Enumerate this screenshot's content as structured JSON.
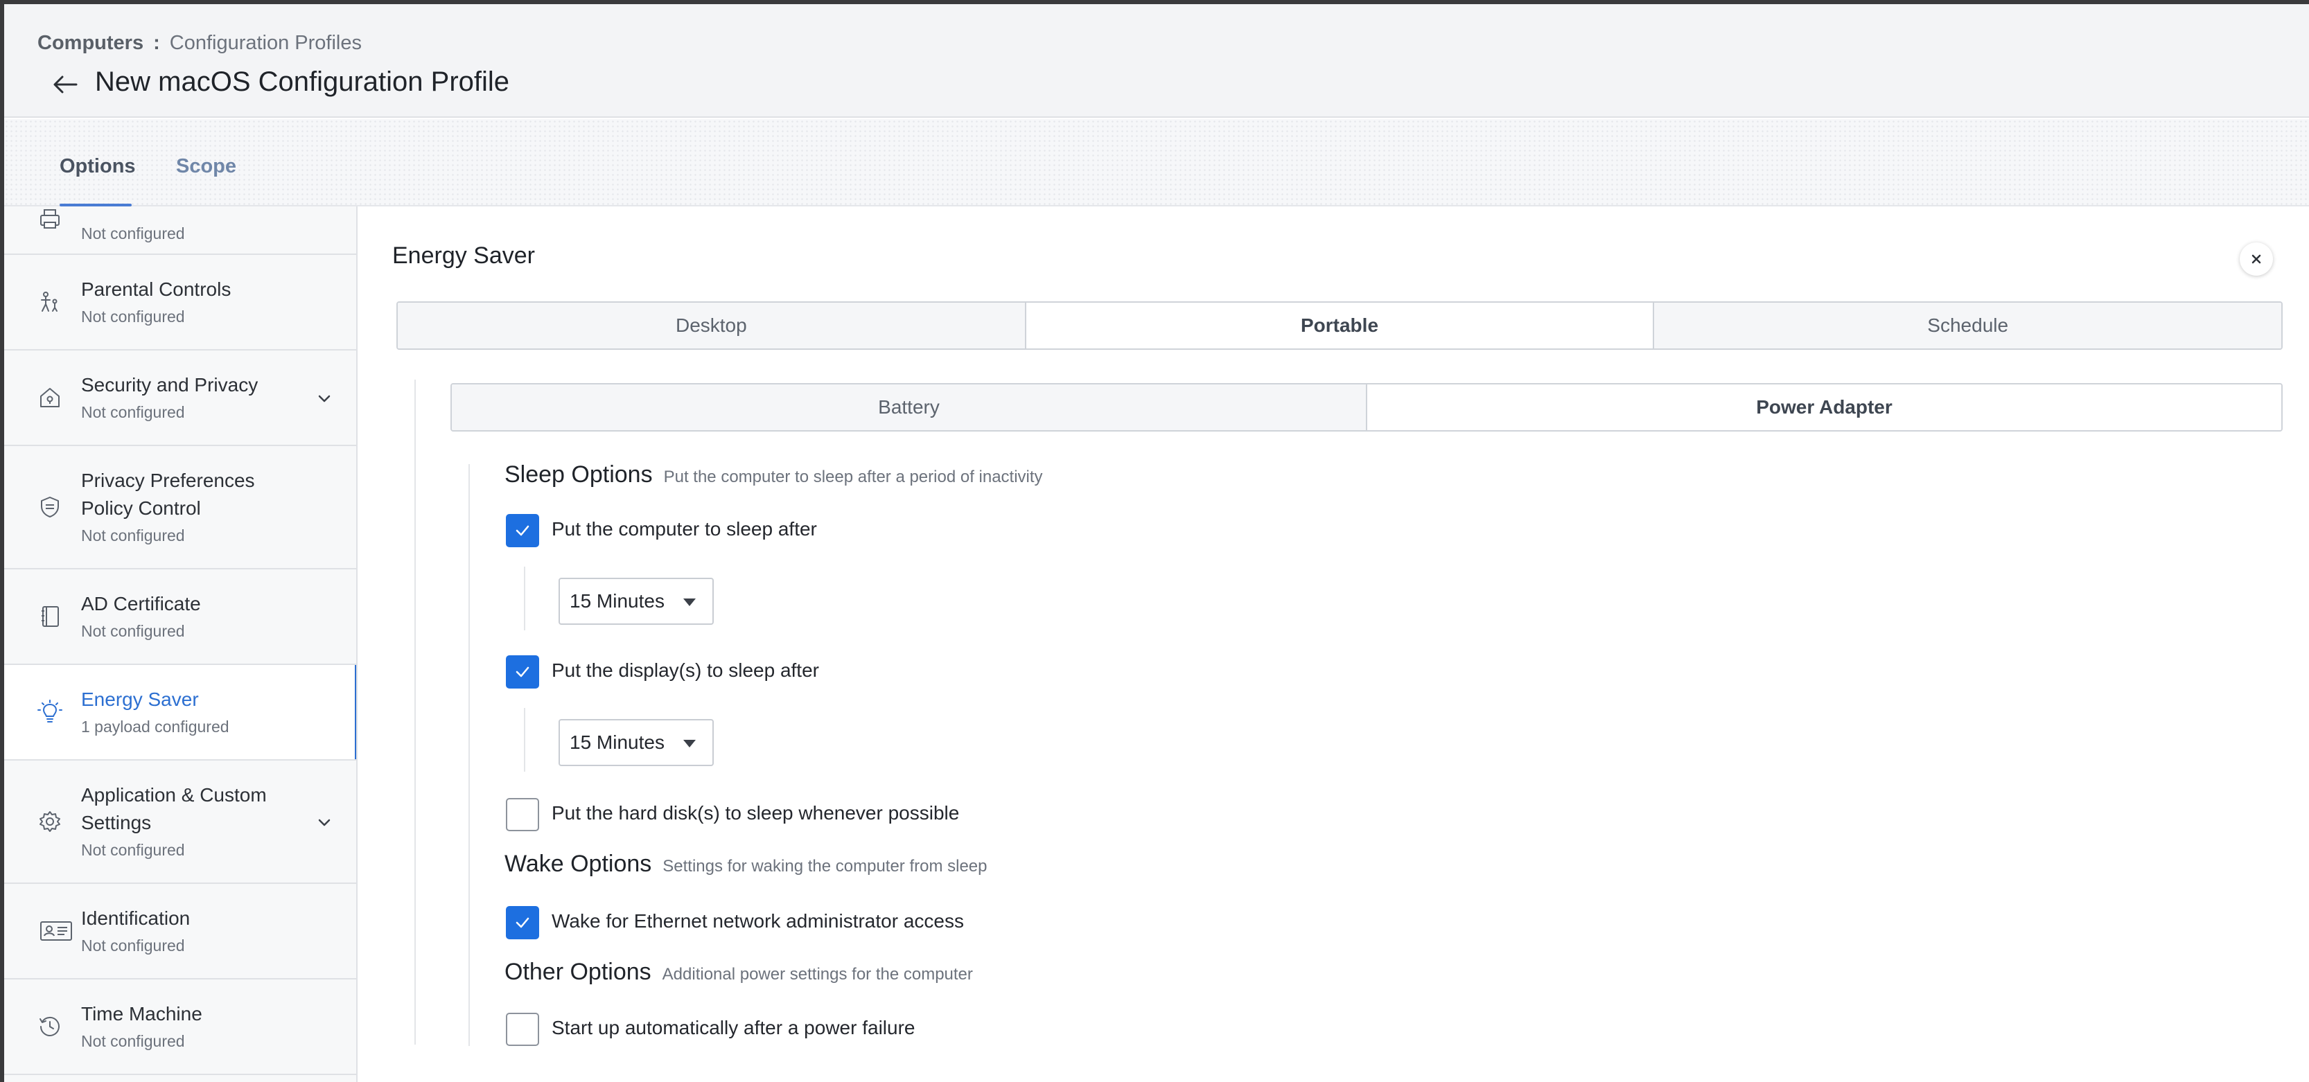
{
  "header": {
    "breadcrumb_root": "Computers",
    "breadcrumb_separator": ":",
    "breadcrumb_current": "Configuration Profiles",
    "title": "New macOS Configuration Profile"
  },
  "tabs": {
    "options": "Options",
    "scope": "Scope"
  },
  "sidebar": {
    "items": [
      {
        "label": "",
        "sub": "Not configured",
        "icon": "printer-icon"
      },
      {
        "label": "Parental Controls",
        "sub": "Not configured",
        "icon": "parental-controls-icon"
      },
      {
        "label": "Security and Privacy",
        "sub": "Not configured",
        "icon": "security-house-icon"
      },
      {
        "label": "Privacy Preferences Policy Control",
        "sub": "Not configured",
        "icon": "shield-icon"
      },
      {
        "label": "AD Certificate",
        "sub": "Not configured",
        "icon": "certificate-icon"
      },
      {
        "label": "Energy Saver",
        "sub": "1 payload configured",
        "icon": "lightbulb-icon"
      },
      {
        "label": "Application & Custom Settings",
        "sub": "Not configured",
        "icon": "gear-icon"
      },
      {
        "label": "Identification",
        "sub": "Not configured",
        "icon": "id-card-icon"
      },
      {
        "label": "Time Machine",
        "sub": "Not configured",
        "icon": "time-machine-icon"
      }
    ]
  },
  "panel": {
    "title": "Energy Saver",
    "top_tabs": [
      "Desktop",
      "Portable",
      "Schedule"
    ],
    "sub_tabs": [
      "Battery",
      "Power Adapter"
    ],
    "sleep": {
      "title": "Sleep Options",
      "desc": "Put the computer to sleep after a period of inactivity",
      "computer_label": "Put the computer to sleep after",
      "computer_value": "15 Minutes",
      "display_label": "Put the display(s) to sleep after",
      "display_value": "15 Minutes",
      "disk_label": "Put the hard disk(s) to sleep whenever possible"
    },
    "wake": {
      "title": "Wake Options",
      "desc": "Settings for waking the computer from sleep",
      "ethernet_label": "Wake for Ethernet network administrator access"
    },
    "other": {
      "title": "Other Options",
      "desc": "Additional power settings for the computer",
      "startup_label": "Start up automatically after a power failure"
    }
  },
  "colors": {
    "accent": "#1d6fe0",
    "active_sidebar": "#2c6fd1"
  }
}
